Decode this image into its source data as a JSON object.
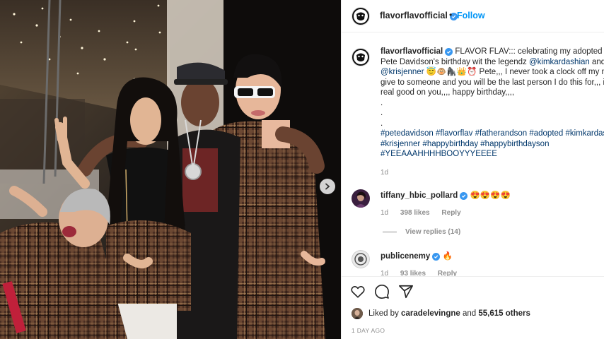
{
  "post": {
    "username": "flavorflavofficial",
    "follow_label": "Follow",
    "separator": "•",
    "photo_alt": "photo of five people posing",
    "caption": {
      "username": "flavorflavofficial",
      "text_1": "FLAVOR FLAV::: celebrating my adopted son Pete Davidson's birthday wit the legendz",
      "mention_1": "@kimkardashian",
      "text_2": "and",
      "mention_2": "@krisjenner",
      "emojis": "😇🐵🦍👑⏰",
      "text_3": "Pete,,, I never took a clock off my neck to give to someone and you will be the last person I do this for,,, it lookz real good on you,,,, happy birthday,,,,",
      "dots": [
        ".",
        ".",
        "."
      ],
      "hashtags": "#petedavidson #flavorflav #fatherandson #adopted #kimkardashian #krisjenner #happybirthday #happybirthdayson #YEEAAAHHHHBOOYYYEEEE",
      "time": "1d"
    },
    "comments": [
      {
        "username": "tiffany_hbic_pollard",
        "text": "😍😍😍😍",
        "time": "1d",
        "likes": "398 likes",
        "reply": "Reply",
        "view_replies": "View replies (14)"
      },
      {
        "username": "publicenemy",
        "text": "🔥",
        "time": "1d",
        "likes": "93 likes",
        "reply": "Reply"
      }
    ],
    "liked_by_prefix": "Liked by",
    "liked_by_user": "caradelevingne",
    "liked_by_and": "and",
    "liked_by_count": "55,615 others",
    "date": "1 DAY AGO",
    "accent_color": "#0095f6",
    "icons": [
      "heart-icon",
      "comment-icon",
      "share-icon",
      "chevron-right-icon",
      "verified-icon"
    ]
  }
}
